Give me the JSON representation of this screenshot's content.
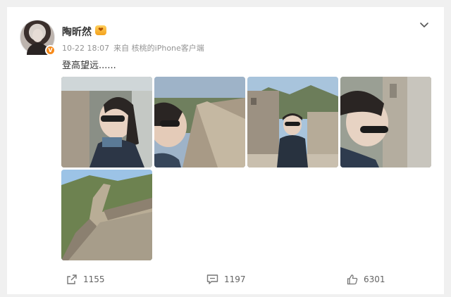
{
  "post": {
    "author": "陶昕然",
    "timestamp": "10-22 18:07",
    "source": "来自 核桃的iPhone客户端",
    "text": "登高望远......",
    "photos": [
      {
        "name": "photo-1"
      },
      {
        "name": "photo-2"
      },
      {
        "name": "photo-3"
      },
      {
        "name": "photo-4"
      },
      {
        "name": "photo-5"
      }
    ]
  },
  "actions": {
    "share_count": "1155",
    "comment_count": "1197",
    "like_count": "6301"
  },
  "colors": {
    "accent": "#f78a1b",
    "text": "#333333",
    "meta": "#939393"
  },
  "icons": {
    "share": "share-icon",
    "comment": "comment-icon",
    "like": "like-icon",
    "menu": "chevron-down-icon"
  }
}
